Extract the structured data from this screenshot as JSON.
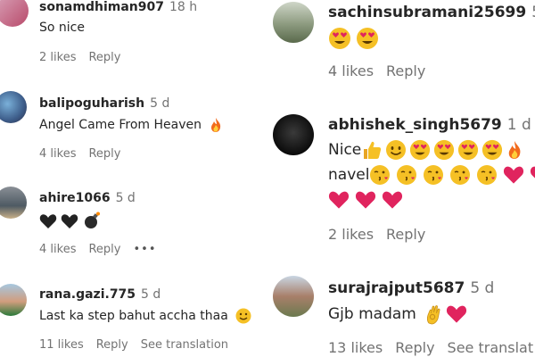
{
  "left": [
    {
      "username": "sonamdhiman907",
      "time": "18 h",
      "text": "So nice",
      "likes": "2 likes",
      "reply": "Reply",
      "emoji": []
    },
    {
      "username": "balipoguharish",
      "time": "5 d",
      "text": "Angel Came From Heaven",
      "likes": "4 likes",
      "reply": "Reply",
      "emoji": [
        "fire"
      ]
    },
    {
      "username": "ahire1066",
      "time": "5 d",
      "text": "",
      "likes": "4 likes",
      "reply": "Reply",
      "more": "•••",
      "emoji": [
        "black-heart",
        "black-heart",
        "bomb"
      ]
    },
    {
      "username": "rana.gazi.775",
      "time": "5 d",
      "text": "Last ka step bahut accha thaa",
      "likes": "11 likes",
      "reply": "Reply",
      "see_translation": "See translation",
      "emoji": [
        "smile"
      ]
    }
  ],
  "right": [
    {
      "username": "sachinsubramani25699",
      "time": "5",
      "text": "",
      "likes": "4 likes",
      "reply": "Reply",
      "emoji": [
        "heart-eyes",
        "heart-eyes"
      ]
    },
    {
      "username": "abhishek_singh5679",
      "time": "1 d",
      "line1": "Nice",
      "line2": "navel",
      "likes": "2 likes",
      "reply": "Reply",
      "emoji_line1": [
        "thumbs-up",
        "smile",
        "heart-eyes",
        "heart-eyes",
        "heart-eyes",
        "heart-eyes",
        "fire"
      ],
      "emoji_line2": [
        "kiss",
        "kiss",
        "kiss",
        "kiss",
        "kiss",
        "red-heart",
        "red-heart"
      ],
      "emoji_line3": [
        "red-heart",
        "red-heart",
        "red-heart"
      ]
    },
    {
      "username": "surajrajput5687",
      "time": "5 d",
      "text": "Gjb madam",
      "likes": "13 likes",
      "reply": "Reply",
      "see_translation": "See translat",
      "emoji": [
        "ok-hand",
        "red-heart"
      ]
    }
  ],
  "colors": {
    "username": "#262626",
    "meta": "#737373",
    "heart": "#e0245e",
    "emoji_face": "#f5c025",
    "black_heart": "#222222"
  }
}
